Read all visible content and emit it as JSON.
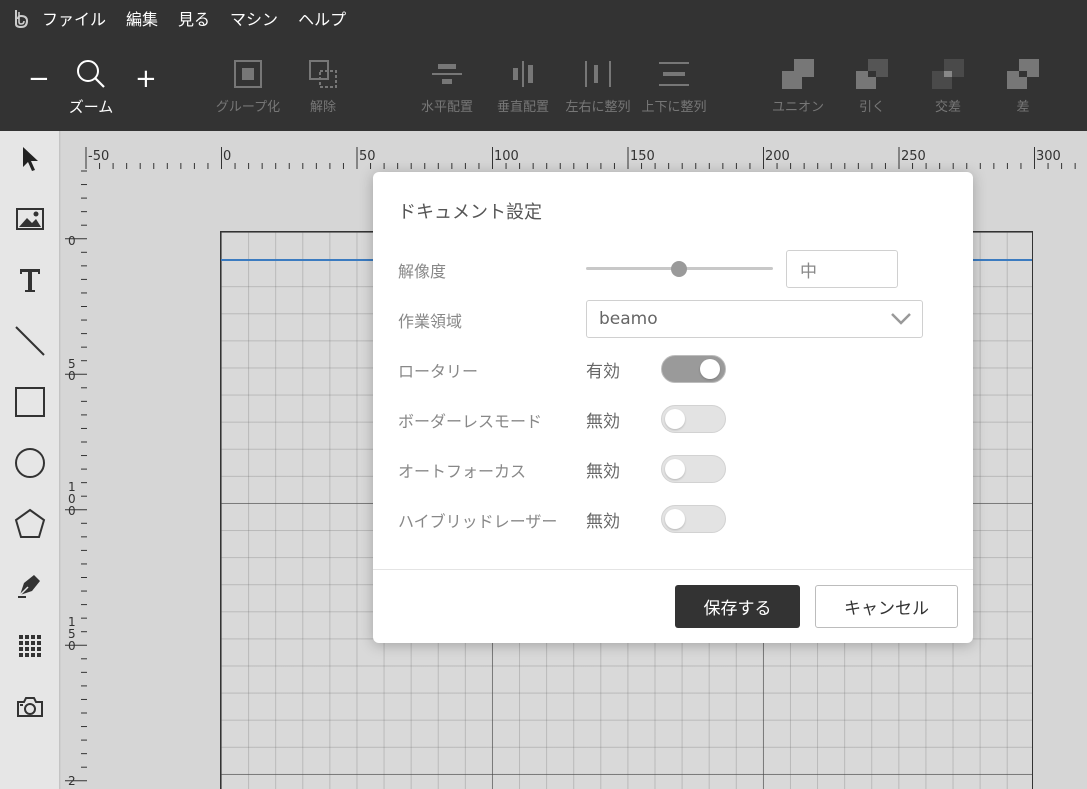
{
  "menu": {
    "logo_icon": "beam-studio-logo-icon",
    "items": [
      "ファイル",
      "編集",
      "見る",
      "マシン",
      "ヘルプ"
    ]
  },
  "toolbar": {
    "zoom_minus": "−",
    "zoom_plus": "+",
    "zoom_label": "ズーム",
    "group_label": "グループ化",
    "ungroup_label": "解除",
    "hcenter_label": "水平配置",
    "vcenter_label": "垂直配置",
    "left_align_label": "左右に整列",
    "top_align_label": "上下に整列",
    "union_label": "ユニオン",
    "subtract_label": "引く",
    "intersect_label": "交差",
    "difference_label": "差"
  },
  "tools": [
    "select-arrow-icon",
    "image-icon",
    "text-icon",
    "line-icon",
    "rectangle-icon",
    "ellipse-icon",
    "polygon-icon",
    "pen-icon",
    "grid-icon",
    "camera-icon"
  ],
  "ruler": {
    "top_labels": [
      "-50",
      "0",
      "50",
      "100",
      "150",
      "200",
      "250",
      "300"
    ],
    "left_labels": [
      "0",
      "5\n0",
      "1\n0\n0",
      "1\n5\n0",
      "2"
    ]
  },
  "dialog": {
    "title": "ドキュメント設定",
    "resolution_label": "解像度",
    "resolution_value": "中",
    "resolution_slider_fraction": 0.5,
    "workarea_label": "作業領域",
    "workarea_value": "beamo",
    "rotary_label": "ロータリー",
    "rotary_status": "有効",
    "rotary_enabled": true,
    "borderless_label": "ボーダーレスモード",
    "borderless_status": "無効",
    "borderless_enabled": false,
    "autofocus_label": "オートフォーカス",
    "autofocus_status": "無効",
    "autofocus_enabled": false,
    "hybrid_label": "ハイブリッドレーザー",
    "hybrid_status": "無効",
    "hybrid_enabled": false,
    "save_label": "保存する",
    "cancel_label": "キャンセル"
  }
}
